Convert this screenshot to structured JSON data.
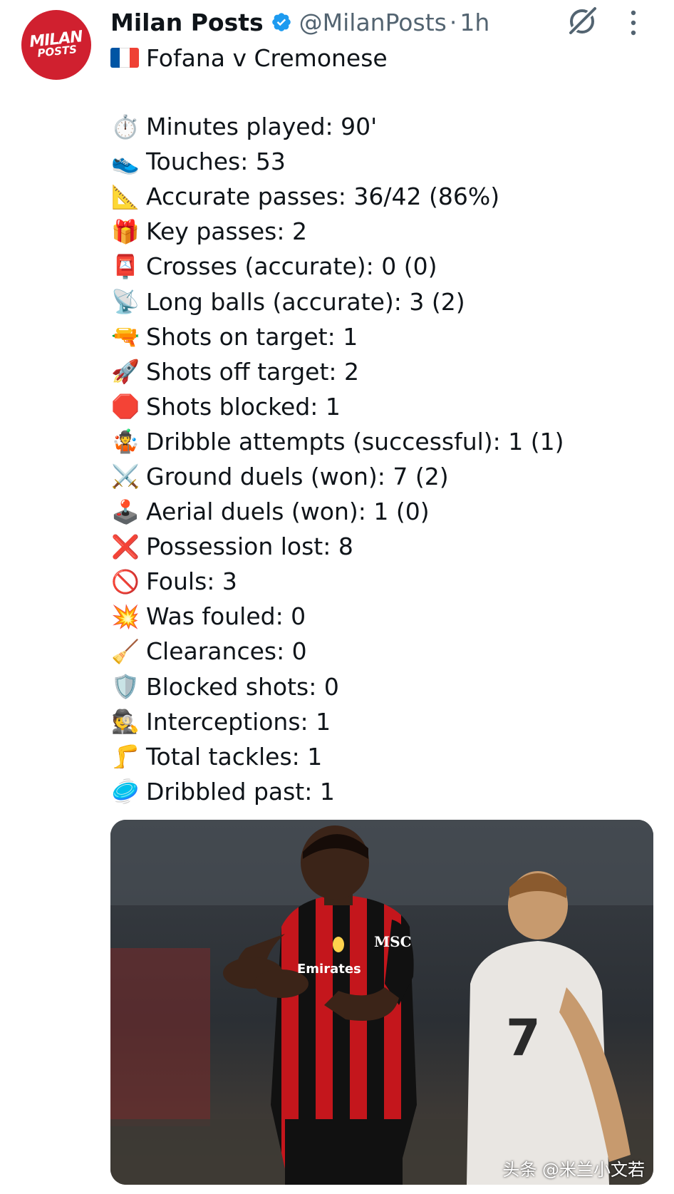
{
  "author": {
    "display_name": "Milan Posts",
    "handle": "@MilanPosts",
    "separator": "·",
    "time_ago": "1h",
    "avatar_line1": "MILAN",
    "avatar_line2": "POSTS",
    "avatar_color": "#d0202f",
    "verified_color": "#1d9bf0"
  },
  "tweet": {
    "title": "Fofana v Cremonese",
    "title_icon": "france-flag-icon",
    "stats": [
      {
        "icon": "stopwatch-icon",
        "emoji": "⏱️",
        "text": "Minutes played: 90'"
      },
      {
        "icon": "running-shoe-icon",
        "emoji": "👟",
        "text": "Touches: 53"
      },
      {
        "icon": "triangle-ruler-icon",
        "emoji": "📐",
        "text": "Accurate passes: 36/42 (86%)"
      },
      {
        "icon": "gift-icon",
        "emoji": "🎁",
        "text": "Key passes: 2"
      },
      {
        "icon": "postbox-icon",
        "emoji": "📮",
        "text": "Crosses (accurate): 0 (0)"
      },
      {
        "icon": "satellite-dish-icon",
        "emoji": "📡",
        "text": "Long balls (accurate): 3 (2)"
      },
      {
        "icon": "water-pistol-icon",
        "emoji": "🔫",
        "text": "Shots on target: 1"
      },
      {
        "icon": "firework-rocket-icon",
        "emoji": "🚀",
        "text": "Shots off target: 2"
      },
      {
        "icon": "stop-sign-icon",
        "emoji": "🛑",
        "text": "Shots blocked: 1"
      },
      {
        "icon": "juggler-icon",
        "emoji": "🤹",
        "text": "Dribble attempts (successful): 1 (1)"
      },
      {
        "icon": "crossed-swords-icon",
        "emoji": "⚔️",
        "text": "Ground duels (won): 7 (2)"
      },
      {
        "icon": "joystick-icon",
        "emoji": "🕹️",
        "text": "Aerial duels (won): 1 (0)"
      },
      {
        "icon": "cross-mark-icon",
        "emoji": "❌",
        "text": "Possession lost: 8"
      },
      {
        "icon": "prohibited-icon",
        "emoji": "🚫",
        "text": "Fouls: 3"
      },
      {
        "icon": "collision-icon",
        "emoji": "💥",
        "text": "Was fouled: 0"
      },
      {
        "icon": "broom-icon",
        "emoji": "🧹",
        "text": "Clearances: 0"
      },
      {
        "icon": "shield-icon",
        "emoji": "🛡️",
        "text": "Blocked shots: 0"
      },
      {
        "icon": "detective-icon",
        "emoji": "🕵️",
        "text": "Interceptions: 1"
      },
      {
        "icon": "leg-icon",
        "emoji": "🦵",
        "text": "Total tackles: 1"
      },
      {
        "icon": "flying-disc-icon",
        "emoji": "🥏",
        "text": "Dribbled past: 1"
      }
    ]
  },
  "media": {
    "shirt_sponsor": "MSC",
    "shirt_sponsor_partial": "Emirates",
    "opponent_shirt_number": "7",
    "watermark": "头条 @米兰小文若"
  }
}
